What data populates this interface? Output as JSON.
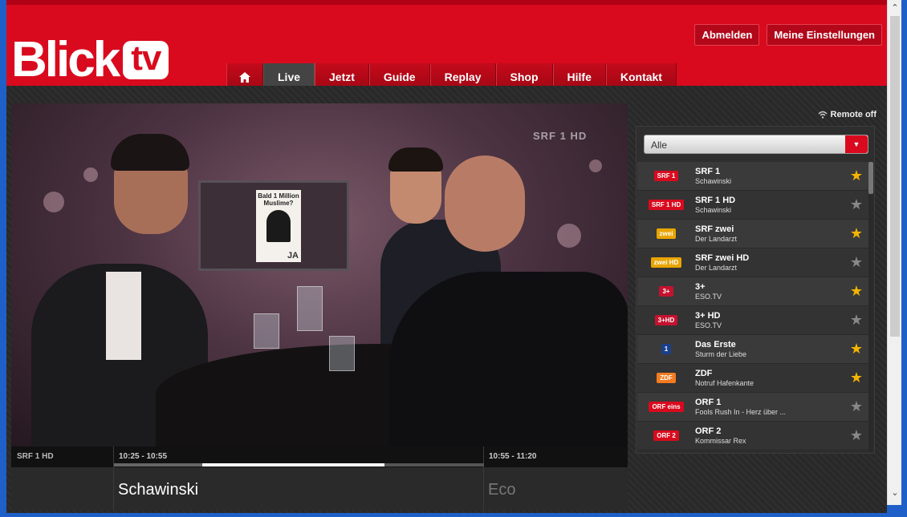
{
  "header": {
    "logo_text": "Blick",
    "logo_tv": "tv",
    "logout_label": "Abmelden",
    "settings_label": "Meine Einstellungen"
  },
  "nav": {
    "home_icon": "home-icon",
    "items": [
      "Live",
      "Jetzt",
      "Guide",
      "Replay",
      "Shop",
      "Hilfe",
      "Kontakt"
    ],
    "active": "Live"
  },
  "player": {
    "watermark": "SRF 1 HD",
    "poster_title": "Bald 1 Million Muslime?",
    "poster_footer": "JA"
  },
  "infobar": {
    "channel": "SRF 1 HD",
    "current_time": "10:25 - 10:55",
    "current_title": "Schawinski",
    "next_time": "10:55 - 11:20",
    "next_title": "Eco",
    "progress": 0.73
  },
  "sidebar": {
    "remote_label": "Remote off",
    "filter_value": "Alle",
    "channels": [
      {
        "name": "SRF 1",
        "program": "Schawinski",
        "logo": "SRF 1",
        "logo_color": "#d90a1e",
        "favorite": true
      },
      {
        "name": "SRF 1 HD",
        "program": "Schawinski",
        "logo": "SRF 1 HD",
        "logo_color": "#d90a1e",
        "favorite": false
      },
      {
        "name": "SRF zwei",
        "program": "Der Landarzt",
        "logo": "zwei",
        "logo_color": "#e8a400",
        "favorite": true
      },
      {
        "name": "SRF zwei HD",
        "program": "Der Landarzt",
        "logo": "zwei HD",
        "logo_color": "#e8a400",
        "favorite": false
      },
      {
        "name": "3+",
        "program": "ESO.TV",
        "logo": "3+",
        "logo_color": "#c4122f",
        "favorite": true
      },
      {
        "name": "3+ HD",
        "program": "ESO.TV",
        "logo": "3+HD",
        "logo_color": "#c4122f",
        "favorite": false
      },
      {
        "name": "Das Erste",
        "program": "Sturm der Liebe",
        "logo": "1",
        "logo_color": "#1b3f8c",
        "favorite": true
      },
      {
        "name": "ZDF",
        "program": "Notruf Hafenkante",
        "logo": "ZDF",
        "logo_color": "#f47b20",
        "favorite": true
      },
      {
        "name": "ORF 1",
        "program": "Fools Rush In - Herz über ...",
        "logo": "ORF eins",
        "logo_color": "#d90a1e",
        "favorite": false
      },
      {
        "name": "ORF 2",
        "program": "Kommissar Rex",
        "logo": "ORF 2",
        "logo_color": "#d90a1e",
        "favorite": false
      }
    ]
  },
  "colors": {
    "brand_red": "#d90a1e",
    "star_active": "#f4b400",
    "star_inactive": "#888888"
  }
}
